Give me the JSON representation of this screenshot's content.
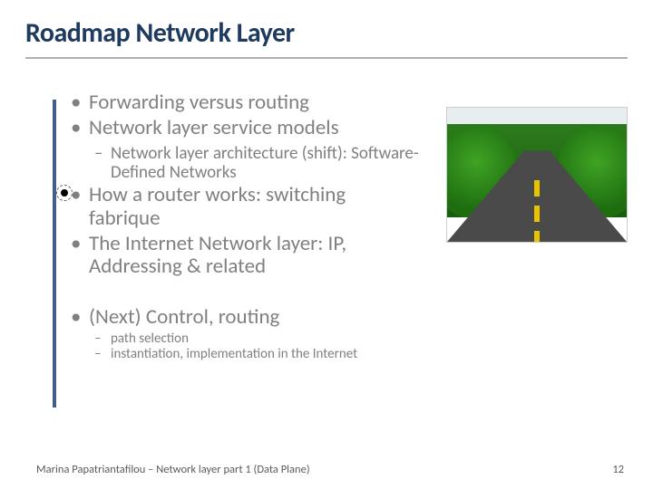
{
  "title": "Roadmap Network Layer",
  "bullets": {
    "b1": "Forwarding versus routing",
    "b2": "Network layer service models",
    "b2_sub": "Network layer architecture (shift): Software-Defined Networks",
    "b3": "How a router works: switching fabrique",
    "b4": "The Internet Network layer: IP, Addressing & related",
    "b5": "(Next) Control, routing",
    "b5_sub1": "path selection",
    "b5_sub2": "instantiation, implementation in the Internet"
  },
  "footer": {
    "left": "Marina Papatriantafilou – Network layer part 1 (Data Plane)",
    "page": "12"
  }
}
